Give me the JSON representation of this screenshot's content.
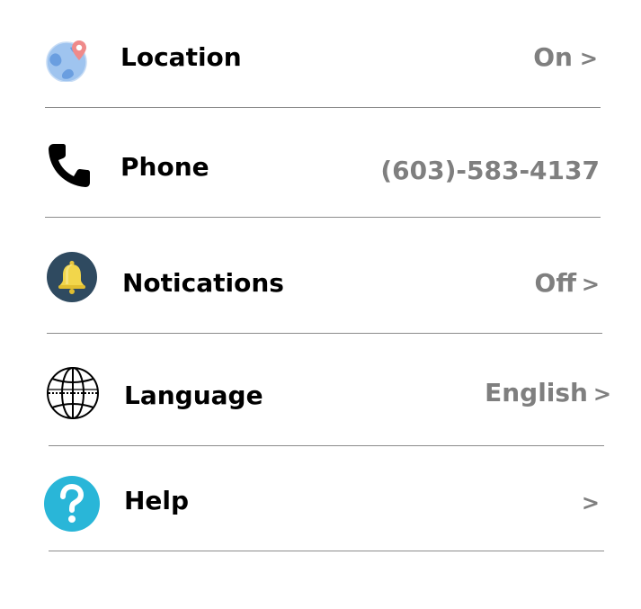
{
  "settings": {
    "location": {
      "label": "Location",
      "value": "On",
      "chevron": ">",
      "icon": "globe-location-icon"
    },
    "phone": {
      "label": "Phone",
      "value": "(603)-583-4137",
      "icon": "phone-icon"
    },
    "notifications": {
      "label": "Notications",
      "value": "Off",
      "chevron": ">",
      "icon": "bell-icon"
    },
    "language": {
      "label": "Language",
      "value": "English",
      "chevron": ">",
      "icon": "globe-language-icon"
    },
    "help": {
      "label": "Help",
      "chevron": ">",
      "icon": "help-icon"
    }
  },
  "colors": {
    "label": "#000000",
    "value": "#7f7f7f",
    "divider": "#8c8c8c",
    "help_accent": "#29b6d8",
    "bell_bg": "#2f4a60",
    "bell_fill": "#f2d64b"
  }
}
